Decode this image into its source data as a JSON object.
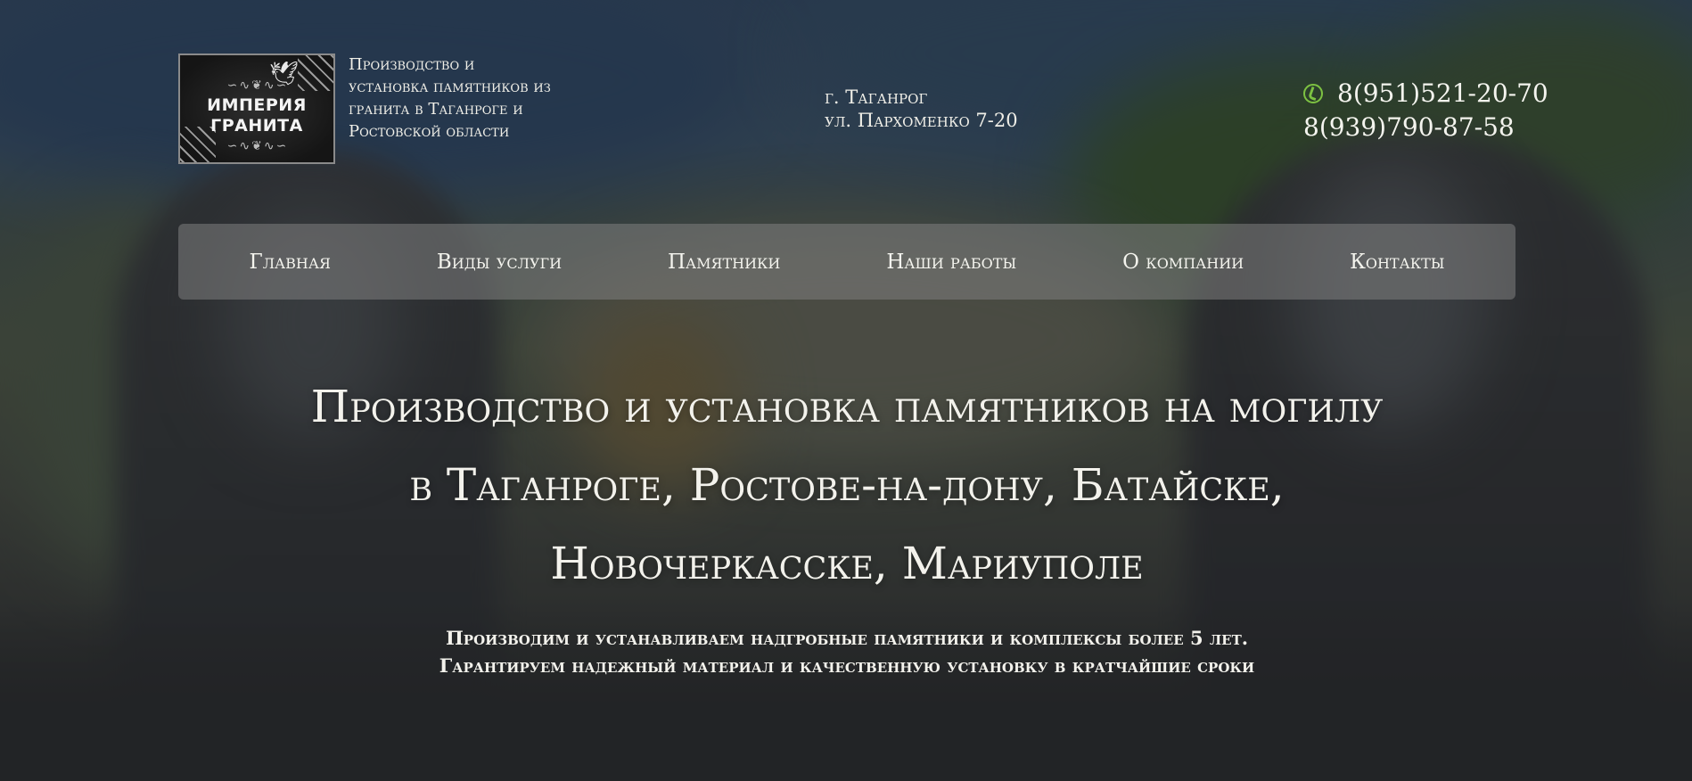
{
  "header": {
    "logo": {
      "line1": "ИМПЕРИЯ",
      "line2": "ГРАНИТА",
      "icon": "dove-icon"
    },
    "tagline": "Производство и установка памятников из гранита в Таганроге и Ростовской области",
    "address": {
      "city": "г. Таганрог",
      "street": "ул. Пархоменко 7-20"
    },
    "phones": {
      "icon": "phone-icon",
      "icon_color": "#7dc242",
      "phone1": "8(951)521-20-70",
      "phone2": "8(939)790-87-58"
    }
  },
  "nav": {
    "items": [
      {
        "label": "Главная"
      },
      {
        "label": "Виды услуги"
      },
      {
        "label": "Памятники"
      },
      {
        "label": "Наши работы"
      },
      {
        "label": "О компании"
      },
      {
        "label": "Контакты"
      }
    ]
  },
  "hero": {
    "title_line1": "Производство и установка памятников на могилу",
    "title_line2": "в Таганроге, Ростове-на-дону, Батайске,",
    "title_line3": "Новочеркасске, Мариуполе",
    "subtitle_line1": "Производим и устанавливаем надгробные памятники и комплексы более 5 лет.",
    "subtitle_line2": "Гарантируем надежный материал и качественную установку в кратчайшие сроки"
  }
}
